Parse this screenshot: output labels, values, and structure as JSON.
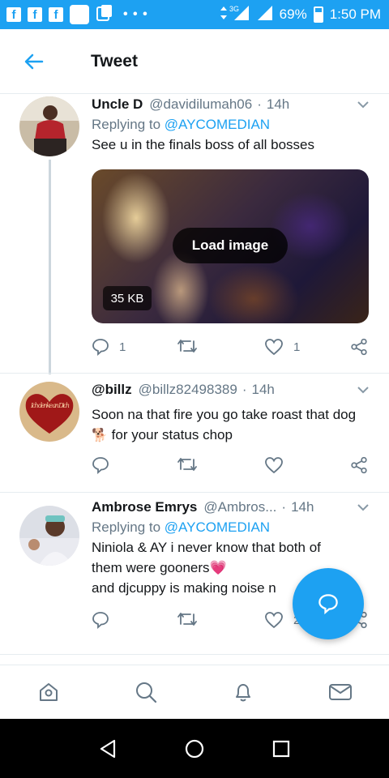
{
  "status_bar": {
    "fb_letter": "f",
    "network": "3G",
    "battery": "69%",
    "battery_level": 0.69,
    "time": "1:50 PM"
  },
  "header": {
    "title": "Tweet",
    "back_icon": "arrow-left-icon"
  },
  "tweets": [
    {
      "name": "Uncle D",
      "handle": "@davidilumah06",
      "dot": "·",
      "time": "14h",
      "replying_prefix": "Replying to",
      "replying_to": "@AYCOMEDIAN",
      "text": "See u in the finals boss of all bosses",
      "media": {
        "button": "Load image",
        "size": "35 KB"
      },
      "actions": {
        "replies": "1",
        "retweets": "",
        "likes": "1"
      }
    },
    {
      "name": "@billz",
      "handle": "@billz82498389",
      "dot": "·",
      "time": "14h",
      "text_before": "Soon na that fire you go take roast that dog",
      "emoji": "🐕",
      "text_after": " for your status chop",
      "avatar_text": "Ich denke an Dich",
      "actions": {
        "replies": "",
        "retweets": "",
        "likes": ""
      }
    },
    {
      "name": "Ambrose Emrys",
      "handle": "@Ambros...",
      "dot": "·",
      "time": "14h",
      "replying_prefix": "Replying to",
      "replying_to": "@AYCOMEDIAN",
      "text_line1": "Niniola & AY i never know that both of",
      "text_line2": "them were gooners",
      "emoji": "💗",
      "text_line3": "and djcuppy is making noise n",
      "actions": {
        "replies": "",
        "retweets": "",
        "likes": "2"
      }
    }
  ],
  "colors": {
    "accent": "#1da1f2",
    "muted": "#657786",
    "text": "#14171a"
  },
  "bottom_nav": [
    "home-icon",
    "search-icon",
    "notifications-icon",
    "messages-icon"
  ],
  "system_nav": [
    "back-triangle-icon",
    "home-circle-icon",
    "recents-square-icon"
  ]
}
